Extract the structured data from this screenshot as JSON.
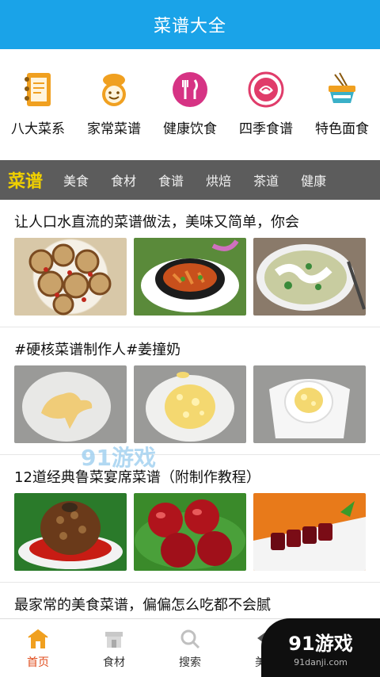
{
  "appbar": {
    "title": "菜谱大全"
  },
  "quicknav": [
    {
      "label": "八大菜系",
      "icon": "notebook-icon",
      "color": "#f0a020"
    },
    {
      "label": "家常菜谱",
      "icon": "chef-icon",
      "color": "#f0a020"
    },
    {
      "label": "健康饮食",
      "icon": "fork-knife-icon",
      "color": "#d63384"
    },
    {
      "label": "四季食谱",
      "icon": "cabbage-icon",
      "color": "#e03c6a"
    },
    {
      "label": "特色面食",
      "icon": "noodle-bowl-icon",
      "color": "#f0a020"
    }
  ],
  "tabs": [
    {
      "label": "菜谱",
      "active": true
    },
    {
      "label": "美食"
    },
    {
      "label": "食材"
    },
    {
      "label": "食谱"
    },
    {
      "label": "烘焙"
    },
    {
      "label": "茶道"
    },
    {
      "label": "健康"
    }
  ],
  "articles": [
    {
      "title": "让人口水直流的菜谱做法，美味又简单，你会"
    },
    {
      "title": "#硬核菜谱制作人#姜撞奶"
    },
    {
      "title": "12道经典鲁菜宴席菜谱（附制作教程）"
    },
    {
      "title": "最家常的美食菜谱，偏偏怎么吃都不会腻"
    }
  ],
  "watermark": {
    "text": "91游戏",
    "url": "91danji.com"
  },
  "bottomnav": [
    {
      "label": "首页",
      "icon": "home-icon",
      "active": true
    },
    {
      "label": "食材",
      "icon": "store-icon"
    },
    {
      "label": "搜索",
      "icon": "search-icon"
    },
    {
      "label": "美食",
      "icon": "hat-icon"
    }
  ],
  "colors": {
    "appbar": "#1aa3e8",
    "tabbar": "#5c5c5c",
    "active_tab": "#f0d000",
    "active_nav": "#e04c1c"
  }
}
